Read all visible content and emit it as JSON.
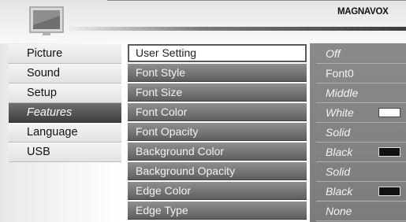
{
  "header": {
    "brand": "MAGNAVOX",
    "icon": "tv-icon"
  },
  "left_menu": {
    "items": [
      {
        "label": "Picture",
        "active": false
      },
      {
        "label": "Sound",
        "active": false
      },
      {
        "label": "Setup",
        "active": false
      },
      {
        "label": "Features",
        "active": true
      },
      {
        "label": "Language",
        "active": false
      },
      {
        "label": "USB",
        "active": false
      }
    ]
  },
  "settings": {
    "rows": [
      {
        "label": "User Setting",
        "value": "Off",
        "selected": true,
        "swatch": null
      },
      {
        "label": "Font Style",
        "value": "Font0",
        "selected": false,
        "swatch": null
      },
      {
        "label": "Font Size",
        "value": "Middle",
        "selected": false,
        "swatch": null
      },
      {
        "label": "Font Color",
        "value": "White",
        "selected": false,
        "swatch": "#ffffff"
      },
      {
        "label": "Font Opacity",
        "value": "Solid",
        "selected": false,
        "swatch": null
      },
      {
        "label": "Background Color",
        "value": "Black",
        "selected": false,
        "swatch": "#111111"
      },
      {
        "label": "Background Opacity",
        "value": "Solid",
        "selected": false,
        "swatch": null
      },
      {
        "label": "Edge Color",
        "value": "Black",
        "selected": false,
        "swatch": "#111111"
      },
      {
        "label": "Edge Type",
        "value": "None",
        "selected": false,
        "swatch": null
      }
    ]
  },
  "colors": {
    "active_menu_bg": "#4a4a4a",
    "settings_row_bg": "#777777",
    "values_bg": "#858585"
  }
}
